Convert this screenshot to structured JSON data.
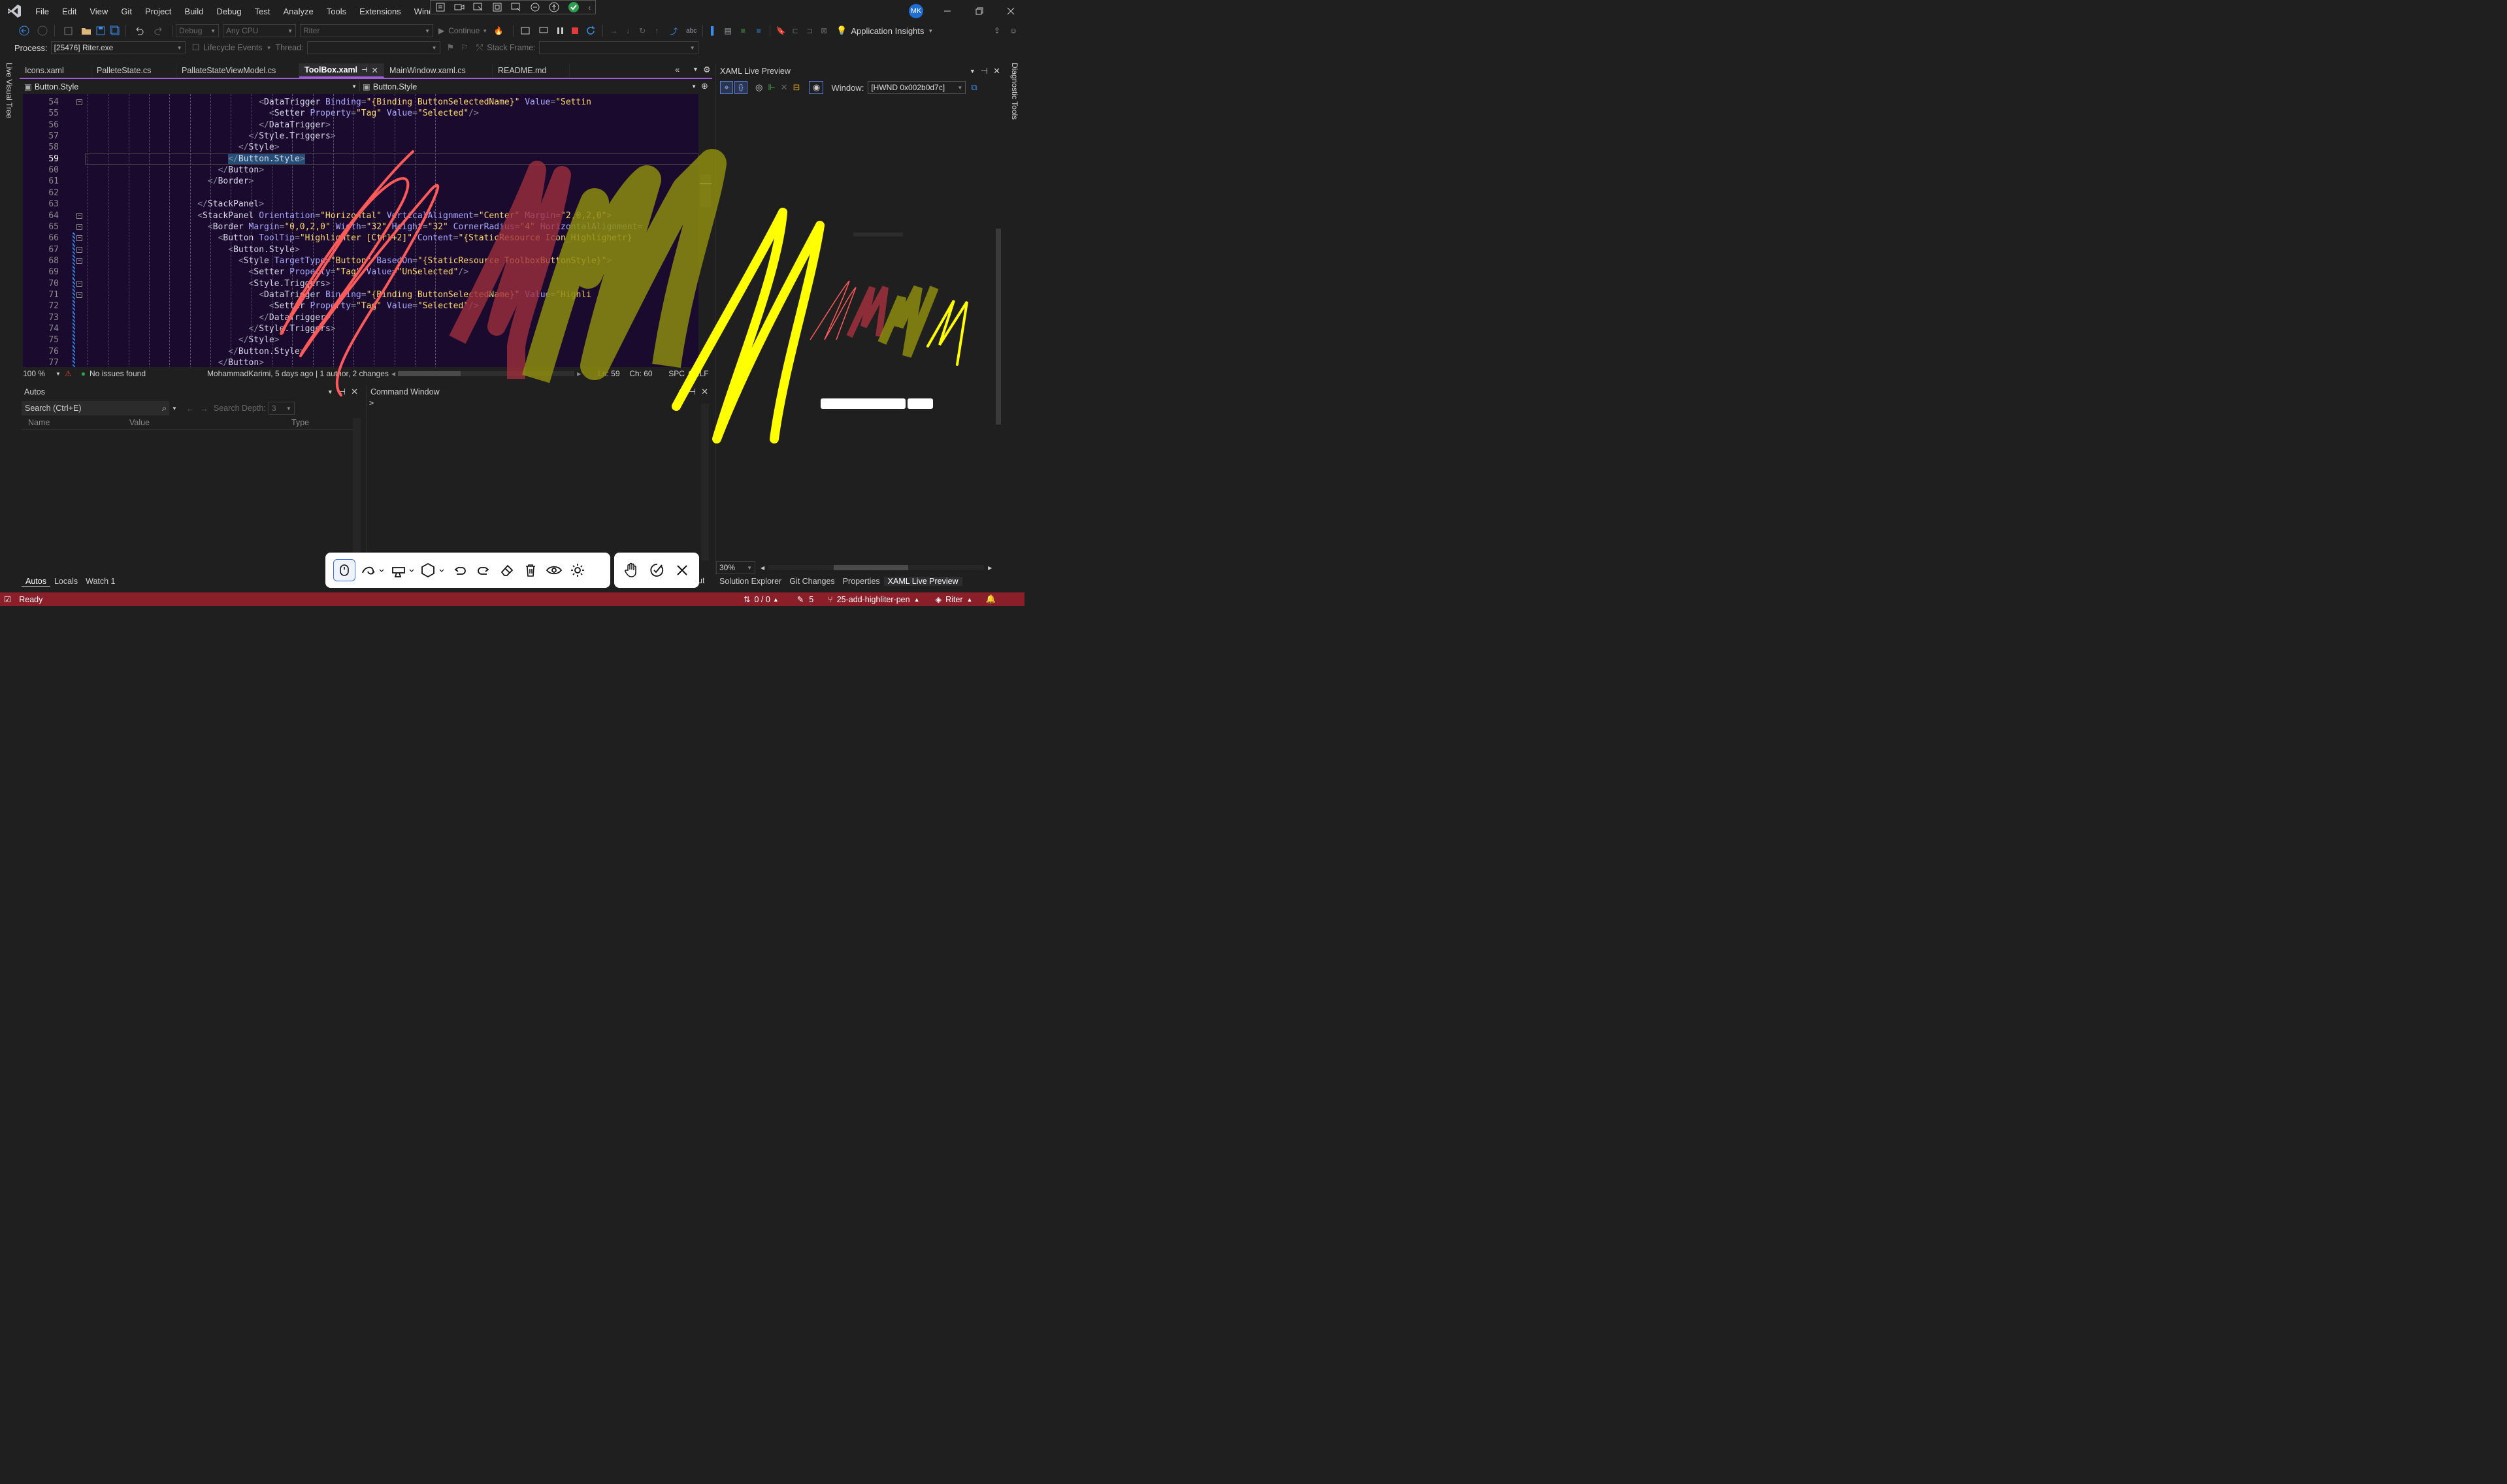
{
  "title_bar": {
    "menu": [
      "File",
      "Edit",
      "View",
      "Git",
      "Project",
      "Build",
      "Debug",
      "Test",
      "Analyze",
      "Tools",
      "Extensions",
      "Window"
    ],
    "user_initials": "MK"
  },
  "toolbar": {
    "config": "Debug",
    "platform": "Any CPU",
    "startup": "Riter",
    "continue_label": "Continue",
    "app_insights": "Application Insights"
  },
  "process_bar": {
    "process_label": "Process:",
    "process_value": "[25476] Riter.exe",
    "lifecycle": "Lifecycle Events",
    "thread_label": "Thread:",
    "stack_frame_label": "Stack Frame:"
  },
  "side": {
    "left": "Live Visual Tree",
    "right": "Diagnostic Tools"
  },
  "tabs": [
    {
      "label": "Icons.xaml",
      "active": false
    },
    {
      "label": "PalleteState.cs",
      "active": false
    },
    {
      "label": "PallateStateViewModel.cs",
      "active": false
    },
    {
      "label": "ToolBox.xaml",
      "active": true
    },
    {
      "label": "MainWindow.xaml.cs",
      "active": false
    },
    {
      "label": "README.md",
      "active": false
    }
  ],
  "nav": {
    "left": "Button.Style",
    "right": "Button.Style"
  },
  "code_lines": [
    {
      "n": "54",
      "indent": 68,
      "html": "<span class=pun>&lt;</span><span class=tag>DataTrigger</span> <span class=att>Binding</span><span class=pun>=</span><span class=val>\"{Binding ButtonSelectedName}\"</span> <span class=att>Value</span><span class=pun>=</span><span class=val>\"Settin</span>"
    },
    {
      "n": "55",
      "indent": 72,
      "html": "<span class=pun>&lt;</span><span class=tag>Setter</span> <span class=att>Property</span><span class=pun>=</span><span class=val>\"Tag\"</span> <span class=att>Value</span><span class=pun>=</span><span class=val>\"Selected\"</span><span class=pun>/&gt;</span>"
    },
    {
      "n": "56",
      "indent": 68,
      "html": "<span class=pun>&lt;/</span><span class=tag>DataTrigger</span><span class=pun>&gt;</span>"
    },
    {
      "n": "57",
      "indent": 64,
      "html": "<span class=pun>&lt;/</span><span class=tag>Style.Triggers</span><span class=pun>&gt;</span>"
    },
    {
      "n": "58",
      "indent": 60,
      "html": "<span class=pun>&lt;/</span><span class=tag>Style</span><span class=pun>&gt;</span>"
    },
    {
      "n": "59",
      "indent": 56,
      "html": "<span style=\"background:#264f78\"><span class=pun>&lt;/</span><span class=tag>Button.Style</span><span class=pun>&gt;</span></span>",
      "current": true
    },
    {
      "n": "60",
      "indent": 52,
      "html": "<span class=pun>&lt;/</span><span class=tag>Button</span><span class=pun>&gt;</span>"
    },
    {
      "n": "61",
      "indent": 48,
      "html": "<span class=pun>&lt;/</span><span class=tag>Border</span><span class=pun>&gt;</span>"
    },
    {
      "n": "62",
      "indent": 0,
      "html": ""
    },
    {
      "n": "63",
      "indent": 44,
      "html": "<span class=pun>&lt;/</span><span class=tag>StackPanel</span><span class=pun>&gt;</span>"
    },
    {
      "n": "64",
      "indent": 44,
      "html": "<span class=pun>&lt;</span><span class=tag>StackPanel</span> <span class=att>Orientation</span><span class=pun>=</span><span class=val>\"Horizontal\"</span> <span class=att>VerticalAlignment</span><span class=pun>=</span><span class=val>\"Center\"</span> <span class=att>Margin</span><span class=pun>=</span><span class=val>\"2,0,2,0\"</span><span class=pun>&gt;</span>"
    },
    {
      "n": "65",
      "indent": 48,
      "html": "<span class=pun>&lt;</span><span class=tag>Border</span> <span class=att>Margin</span><span class=pun>=</span><span class=val>\"0,0,2,0\"</span> <span class=att>Width</span><span class=pun>=</span><span class=val>\"32\"</span> <span class=att>Height</span><span class=pun>=</span><span class=val>\"32\"</span> <span class=att>CornerRadius</span><span class=pun>=</span><span class=val>\"4\"</span> <span class=att>HorizontalAlignment</span><span class=pun>=</span>"
    },
    {
      "n": "66",
      "indent": 52,
      "html": "<span class=pun>&lt;</span><span class=tag>Button</span> <span class=att>ToolTip</span><span class=pun>=</span><span class=val>\"Highlighter [Ctrl+2]\"</span> <span class=att>Content</span><span class=pun>=</span><span class=val>\"{StaticResource Icon_Highlighetr}</span>"
    },
    {
      "n": "67",
      "indent": 56,
      "html": "<span class=pun>&lt;</span><span class=tag>Button.Style</span><span class=pun>&gt;</span>"
    },
    {
      "n": "68",
      "indent": 60,
      "html": "<span class=pun>&lt;</span><span class=tag>Style</span> <span class=att>TargetType</span><span class=pun>=</span><span class=val>\"Button\"</span> <span class=att>BasedOn</span><span class=pun>=</span><span class=val>\"{StaticResource ToolboxButtonStyle}\"</span><span class=pun>&gt;</span>"
    },
    {
      "n": "69",
      "indent": 64,
      "html": "<span class=pun>&lt;</span><span class=tag>Setter</span> <span class=att>Property</span><span class=pun>=</span><span class=val>\"Tag\"</span> <span class=att>Value</span><span class=pun>=</span><span class=val>\"UnSelected\"</span><span class=pun>/&gt;</span>"
    },
    {
      "n": "70",
      "indent": 64,
      "html": "<span class=pun>&lt;</span><span class=tag>Style.Triggers</span><span class=pun>&gt;</span>"
    },
    {
      "n": "71",
      "indent": 68,
      "html": "<span class=pun>&lt;</span><span class=tag>DataTrigger</span> <span class=att>Binding</span><span class=pun>=</span><span class=val>\"{Binding ButtonSelectedName}\"</span> <span class=att>Value</span><span class=pun>=</span><span class=val>\"Highli</span>"
    },
    {
      "n": "72",
      "indent": 72,
      "html": "<span class=pun>&lt;</span><span class=tag>Setter</span> <span class=att>Property</span><span class=pun>=</span><span class=val>\"Tag\"</span> <span class=att>Value</span><span class=pun>=</span><span class=val>\"Selected\"</span><span class=pun>/&gt;</span>"
    },
    {
      "n": "73",
      "indent": 68,
      "html": "<span class=pun>&lt;/</span><span class=tag>DataTrigger</span><span class=pun>&gt;</span>"
    },
    {
      "n": "74",
      "indent": 64,
      "html": "<span class=pun>&lt;/</span><span class=tag>Style.Triggers</span><span class=pun>&gt;</span>"
    },
    {
      "n": "75",
      "indent": 60,
      "html": "<span class=pun>&lt;/</span><span class=tag>Style</span><span class=pun>&gt;</span>"
    },
    {
      "n": "76",
      "indent": 56,
      "html": "<span class=pun>&lt;/</span><span class=tag>Button.Style</span><span class=pun>&gt;</span>"
    },
    {
      "n": "77",
      "indent": 52,
      "html": "<span class=pun>&lt;/</span><span class=tag>Button</span><span class=pun>&gt;</span>"
    }
  ],
  "editor_status": {
    "zoom": "100 %",
    "issues": "No issues found",
    "blame": "MohammadKarimi, 5 days ago | 1 author, 2 changes",
    "ln": "Ln: 59",
    "ch": "Ch: 60",
    "spc": "SPC",
    "crlf": "CRLF"
  },
  "autos": {
    "title": "Autos",
    "search_placeholder": "Search (Ctrl+E)",
    "search_depth_label": "Search Depth:",
    "search_depth_value": "3",
    "columns": [
      "Name",
      "Value",
      "Type"
    ],
    "tabs": [
      "Autos",
      "Locals",
      "Watch 1"
    ]
  },
  "command_window": {
    "title": "Command Window",
    "prompt": ">",
    "bottom_tab_fragment": "ut"
  },
  "xaml_preview": {
    "title": "XAML Live Preview",
    "window_label": "Window:",
    "window_value": "[HWND 0x002b0d7c]",
    "zoom": "30%",
    "tabs": [
      "Solution Explorer",
      "Git Changes",
      "Properties",
      "XAML Live Preview"
    ]
  },
  "status_bar": {
    "ready": "Ready",
    "sync": "0 / 0",
    "edits": "5",
    "branch": "25-add-highliter-pen",
    "repo": "Riter"
  },
  "colors": {
    "accent": "#9b5cd8",
    "status_bg": "#8a1f2a",
    "pen_red": "#ff5a5a",
    "highlighter_dark_red": "#8b2a35",
    "highlighter_olive": "#8c8c10",
    "pen_yellow": "#ffff00"
  }
}
